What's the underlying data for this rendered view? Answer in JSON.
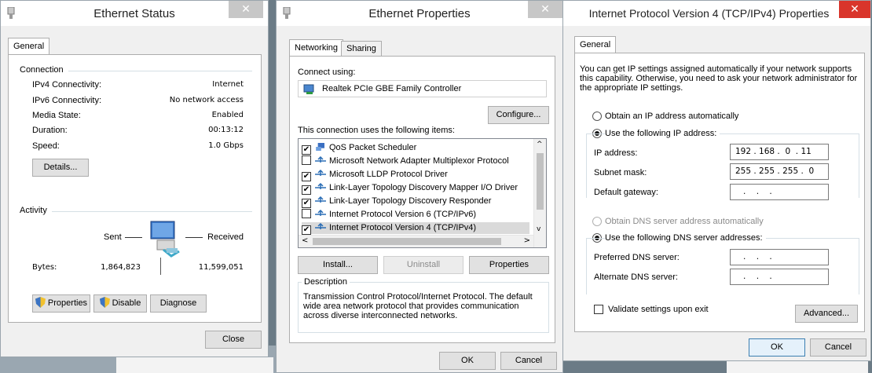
{
  "status": {
    "title": "Ethernet Status",
    "tab_general": "General",
    "connection_header": "Connection",
    "rows": [
      {
        "label": "IPv4 Connectivity:",
        "value": "Internet"
      },
      {
        "label": "IPv6 Connectivity:",
        "value": "No network access"
      },
      {
        "label": "Media State:",
        "value": "Enabled"
      },
      {
        "label": "Duration:",
        "value": "00:13:12"
      },
      {
        "label": "Speed:",
        "value": "1.0 Gbps"
      }
    ],
    "details_btn": "Details...",
    "activity_header": "Activity",
    "sent_label": "Sent",
    "received_label": "Received",
    "bytes_label": "Bytes:",
    "bytes_sent": "1,864,823",
    "bytes_received": "11,599,051",
    "properties_btn": "Properties",
    "disable_btn": "Disable",
    "diagnose_btn": "Diagnose",
    "close_btn": "Close"
  },
  "props": {
    "title": "Ethernet Properties",
    "tab_networking": "Networking",
    "tab_sharing": "Sharing",
    "connect_using": "Connect using:",
    "adapter": "Realtek PCIe GBE Family Controller",
    "configure_btn": "Configure...",
    "items_label": "This connection uses the following items:",
    "items": [
      {
        "checked": true,
        "text": "QoS Packet Scheduler",
        "icon": "qos-icon"
      },
      {
        "checked": false,
        "text": "Microsoft Network Adapter Multiplexor Protocol",
        "icon": "protocol-icon"
      },
      {
        "checked": true,
        "text": "Microsoft LLDP Protocol Driver",
        "icon": "protocol-icon"
      },
      {
        "checked": true,
        "text": "Link-Layer Topology Discovery Mapper I/O Driver",
        "icon": "protocol-icon"
      },
      {
        "checked": true,
        "text": "Link-Layer Topology Discovery Responder",
        "icon": "protocol-icon"
      },
      {
        "checked": false,
        "text": "Internet Protocol Version 6 (TCP/IPv6)",
        "icon": "protocol-icon"
      },
      {
        "checked": true,
        "text": "Internet Protocol Version 4 (TCP/IPv4)",
        "icon": "protocol-icon"
      }
    ],
    "install_btn": "Install...",
    "uninstall_btn": "Uninstall",
    "properties_btn": "Properties",
    "description_header": "Description",
    "description": "Transmission Control Protocol/Internet Protocol. The default wide area network protocol that provides communication across diverse interconnected networks.",
    "ok_btn": "OK",
    "cancel_btn": "Cancel"
  },
  "ipv4": {
    "title": "Internet Protocol Version 4 (TCP/IPv4) Properties",
    "tab_general": "General",
    "intro": "You can get IP settings assigned automatically if your network supports this capability. Otherwise, you need to ask your network administrator for the appropriate IP settings.",
    "obtain_ip_auto": "Obtain an IP address automatically",
    "use_following_ip": "Use the following IP address:",
    "ip_address_label": "IP address:",
    "ip_address": "192 . 168 .  0  . 11",
    "subnet_label": "Subnet mask:",
    "subnet": "255 . 255 . 255 .  0",
    "gateway_label": "Default gateway:",
    "gateway": "   .    .    .",
    "obtain_dns_auto": "Obtain DNS server address automatically",
    "use_following_dns": "Use the following DNS server addresses:",
    "preferred_dns_label": "Preferred DNS server:",
    "preferred_dns": "   .    .    .",
    "alternate_dns_label": "Alternate DNS server:",
    "alternate_dns": "   .    .    .",
    "validate_label": "Validate settings upon exit",
    "advanced_btn": "Advanced...",
    "ok_btn": "OK",
    "cancel_btn": "Cancel"
  },
  "colors": {
    "close_active": "#d9352b",
    "close_inactive": "#c7c7c7",
    "accent": "#3c7fb1"
  }
}
